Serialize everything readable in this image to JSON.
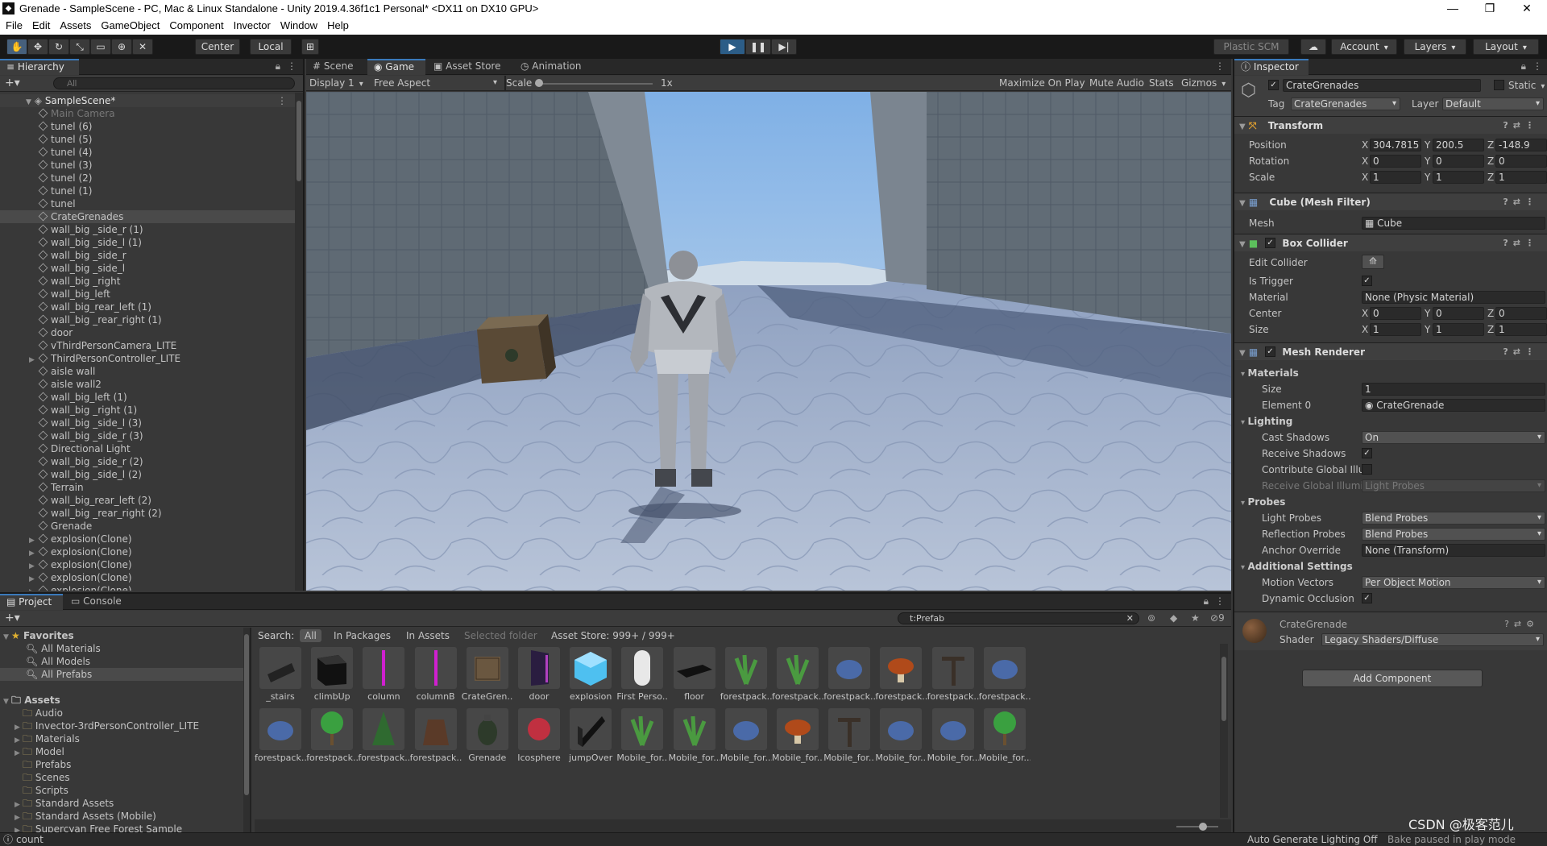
{
  "window": {
    "title": "Grenade - SampleScene - PC, Mac & Linux Standalone - Unity 2019.4.36f1c1 Personal* <DX11 on DX10 GPU>"
  },
  "menu": [
    "File",
    "Edit",
    "Assets",
    "GameObject",
    "Component",
    "Invector",
    "Window",
    "Help"
  ],
  "toolbar": {
    "pivot": "Center",
    "space": "Local",
    "plastic": "Plastic SCM",
    "account": "Account",
    "layers": "Layers",
    "layout": "Layout"
  },
  "hierarchy": {
    "tab": "Hierarchy",
    "search_placeholder": "All",
    "scene": "SampleScene*",
    "items": [
      {
        "label": "Main Camera",
        "dim": true,
        "fold": false
      },
      {
        "label": "tunel (6)",
        "fold": false
      },
      {
        "label": "tunel (5)",
        "fold": false
      },
      {
        "label": "tunel (4)",
        "fold": false
      },
      {
        "label": "tunel (3)",
        "fold": false
      },
      {
        "label": "tunel (2)",
        "fold": false
      },
      {
        "label": "tunel (1)",
        "fold": false
      },
      {
        "label": "tunel",
        "fold": false
      },
      {
        "label": "CrateGrenades",
        "fold": false,
        "selected": true
      },
      {
        "label": "wall_big _side_r (1)",
        "fold": false
      },
      {
        "label": "wall_big _side_l (1)",
        "fold": false
      },
      {
        "label": "wall_big _side_r",
        "fold": false
      },
      {
        "label": "wall_big _side_l",
        "fold": false
      },
      {
        "label": "wall_big _right",
        "fold": false
      },
      {
        "label": "wall_big_left",
        "fold": false
      },
      {
        "label": "wall_big_rear_left (1)",
        "fold": false
      },
      {
        "label": "wall_big _rear_right (1)",
        "fold": false
      },
      {
        "label": "door",
        "fold": false
      },
      {
        "label": "vThirdPersonCamera_LITE",
        "fold": false
      },
      {
        "label": "ThirdPersonController_LITE",
        "fold": true
      },
      {
        "label": "aisle wall",
        "fold": false
      },
      {
        "label": "aisle wall2",
        "fold": false
      },
      {
        "label": "wall_big_left (1)",
        "fold": false
      },
      {
        "label": "wall_big _right (1)",
        "fold": false
      },
      {
        "label": "wall_big _side_l (3)",
        "fold": false
      },
      {
        "label": "wall_big _side_r (3)",
        "fold": false
      },
      {
        "label": "Directional Light",
        "fold": false
      },
      {
        "label": "wall_big _side_r (2)",
        "fold": false
      },
      {
        "label": "wall_big _side_l (2)",
        "fold": false
      },
      {
        "label": "Terrain",
        "fold": false
      },
      {
        "label": "wall_big_rear_left (2)",
        "fold": false
      },
      {
        "label": "wall_big _rear_right (2)",
        "fold": false
      },
      {
        "label": "Grenade",
        "fold": false
      },
      {
        "label": "explosion(Clone)",
        "fold": true
      },
      {
        "label": "explosion(Clone)",
        "fold": true
      },
      {
        "label": "explosion(Clone)",
        "fold": true
      },
      {
        "label": "explosion(Clone)",
        "fold": true
      },
      {
        "label": "explosion(Clone)",
        "fold": true
      }
    ]
  },
  "center_tabs": [
    "Scene",
    "Game",
    "Asset Store",
    "Animation"
  ],
  "game_bar": {
    "display": "Display 1",
    "aspect": "Free Aspect",
    "scale_label": "Scale",
    "scale_value": "1x",
    "maximize": "Maximize On Play",
    "mute": "Mute Audio",
    "stats": "Stats",
    "gizmos": "Gizmos"
  },
  "inspector": {
    "tab": "Inspector",
    "object_name": "CrateGrenades",
    "static": "Static",
    "tag_label": "Tag",
    "tag": "CrateGrenades",
    "layer_label": "Layer",
    "layer": "Default",
    "transform": {
      "title": "Transform",
      "position_label": "Position",
      "rotation_label": "Rotation",
      "scale_label": "Scale",
      "position": [
        "304.7815",
        "200.5",
        "-148.9"
      ],
      "rotation": [
        "0",
        "0",
        "0"
      ],
      "scale": [
        "1",
        "1",
        "1"
      ]
    },
    "mesh_filter": {
      "title": "Cube (Mesh Filter)",
      "mesh_label": "Mesh",
      "mesh": "Cube"
    },
    "box_collider": {
      "title": "Box Collider",
      "edit": "Edit Collider",
      "trigger": "Is Trigger",
      "material_label": "Material",
      "material": "None (Physic Material)",
      "center_label": "Center",
      "center": [
        "0",
        "0",
        "0"
      ],
      "size_label": "Size",
      "size": [
        "1",
        "1",
        "1"
      ]
    },
    "mesh_renderer": {
      "title": "Mesh Renderer",
      "materials": "Materials",
      "size_label": "Size",
      "size": "1",
      "element_label": "Element 0",
      "element": "CrateGrenade",
      "lighting": "Lighting",
      "cast_label": "Cast Shadows",
      "cast": "On",
      "receive_label": "Receive Shadows",
      "contrib_label": "Contribute Global Illu",
      "rgi_label": "Receive Global Illumi",
      "rgi": "Light Probes",
      "probes": "Probes",
      "lp_label": "Light Probes",
      "lp": "Blend Probes",
      "rp_label": "Reflection Probes",
      "rp": "Blend Probes",
      "anchor_label": "Anchor Override",
      "anchor": "None (Transform)",
      "additional": "Additional Settings",
      "mv_label": "Motion Vectors",
      "mv": "Per Object Motion",
      "dyn_label": "Dynamic Occlusion"
    },
    "material": {
      "name": "CrateGrenade",
      "shader_label": "Shader",
      "shader": "Legacy Shaders/Diffuse"
    },
    "add_component": "Add Component",
    "axes": [
      "X",
      "Y",
      "Z"
    ]
  },
  "project": {
    "tabs": [
      "Project",
      "Console"
    ],
    "favorites": "Favorites",
    "fav_items": [
      "All Materials",
      "All Models",
      "All Prefabs"
    ],
    "assets": "Assets",
    "folders": [
      "Audio",
      "Invector-3rdPersonController_LITE",
      "Materials",
      "Model",
      "Prefabs",
      "Scenes",
      "Scripts",
      "Standard Assets",
      "Standard Assets (Mobile)",
      "Supercyan Free Forest Sample"
    ],
    "search_value": "t:Prefab",
    "hidden_count": "9",
    "filters": {
      "search": "Search:",
      "all": "All",
      "packages": "In Packages",
      "in_assets": "In Assets",
      "selected": "Selected folder",
      "store": "Asset Store: 999+ / 999+"
    },
    "row1": [
      "_stairs",
      "climbUp",
      "column",
      "columnB",
      "CrateGren...",
      "door",
      "explosion",
      "First Perso...",
      "floor",
      "forestpack...",
      "forestpack...",
      "forestpack...",
      "forestpack...",
      "forestpack...",
      "forestpack..."
    ],
    "row2": [
      "forestpack...",
      "forestpack...",
      "forestpack...",
      "forestpack...",
      "Grenade",
      "Icosphere",
      "jumpOver",
      "Mobile_for...",
      "Mobile_for...",
      "Mobile_for...",
      "Mobile_for...",
      "Mobile_for...",
      "Mobile_for...",
      "Mobile_for...",
      "Mobile_for..."
    ]
  },
  "statusbar": {
    "left": "count",
    "lighting": "Auto Generate Lighting Off",
    "bake": "Bake paused in play mode",
    "watermark": "CSDN @极客范儿"
  }
}
